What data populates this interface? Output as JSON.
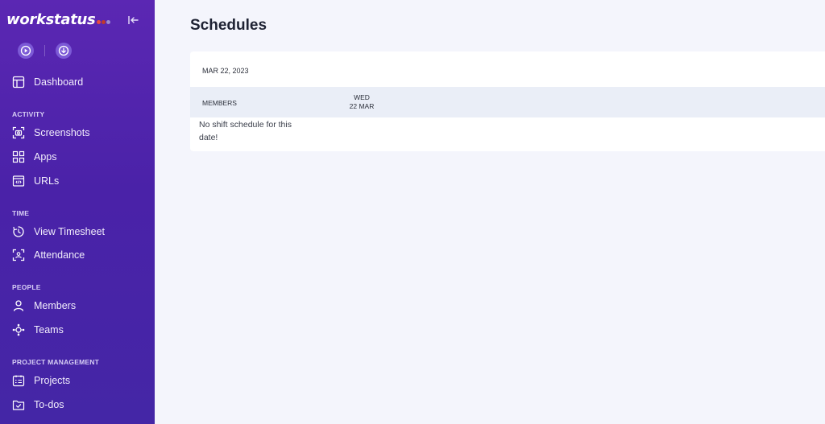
{
  "brand": {
    "name": "workstatus",
    "dot_colors": [
      "#e74c3c",
      "#c0392b",
      "#8e7cc3"
    ]
  },
  "sidebar": {
    "top_item": {
      "label": "Dashboard",
      "icon": "dashboard-icon"
    },
    "sections": [
      {
        "title": "ACTIVITY",
        "items": [
          {
            "label": "Screenshots",
            "icon": "screenshot-icon"
          },
          {
            "label": "Apps",
            "icon": "apps-grid-icon"
          },
          {
            "label": "URLs",
            "icon": "url-icon"
          }
        ]
      },
      {
        "title": "TIME",
        "items": [
          {
            "label": "View Timesheet",
            "icon": "timer-icon"
          },
          {
            "label": "Attendance",
            "icon": "attendance-icon"
          }
        ]
      },
      {
        "title": "PEOPLE",
        "items": [
          {
            "label": "Members",
            "icon": "user-icon"
          },
          {
            "label": "Teams",
            "icon": "teams-icon"
          }
        ]
      },
      {
        "title": "PROJECT MANAGEMENT",
        "items": [
          {
            "label": "Projects",
            "icon": "projects-icon"
          },
          {
            "label": "To-dos",
            "icon": "todos-icon"
          }
        ]
      }
    ]
  },
  "colors": {
    "sidebar_bg": "#5b27b3",
    "page_bg": "#f4f5fc",
    "table_header_bg": "#eaeef7"
  },
  "main": {
    "title": "Schedules",
    "date": "MAR 22, 2023",
    "table": {
      "members_header": "MEMBERS",
      "day": {
        "weekday": "WED",
        "date": "22 MAR"
      }
    },
    "empty_message": "No shift schedule for this date!"
  }
}
